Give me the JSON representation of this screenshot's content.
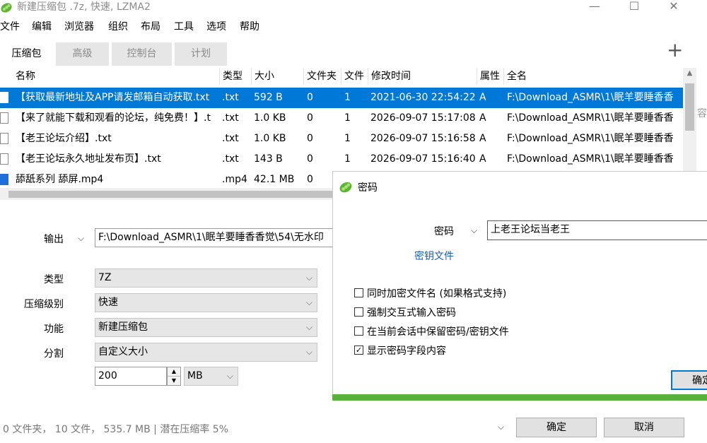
{
  "window": {
    "title": "新建压缩包 .7z, 快速, LZMA2",
    "minimize": "—",
    "maximize": "☐",
    "close": "✕"
  },
  "menu": [
    "文件",
    "编辑",
    "浏览器",
    "组织",
    "布局",
    "工具",
    "选项",
    "帮助"
  ],
  "tabs": [
    "压缩包",
    "高级",
    "控制台",
    "计划"
  ],
  "add_icon": "+",
  "columns": [
    "名称",
    "类型",
    "大小",
    "文件夹",
    "文件",
    "修改时间",
    "属性",
    "全名"
  ],
  "files": [
    {
      "name": "【获取最新地址及APP请发邮箱自动获取.txt",
      "type": ".txt",
      "size": "592 B",
      "folders": "0",
      "files": "1",
      "modified": "2021-06-30 22:54:22",
      "attr": "A",
      "fullname": "F:\\Download_ASMR\\1\\眠羊要睡香香"
    },
    {
      "name": "【来了就能下载和观看的论坛，纯免费！】.t",
      "type": ".txt",
      "size": "1.0 KB",
      "folders": "0",
      "files": "1",
      "modified": "2026-09-07 15:17:08",
      "attr": "A",
      "fullname": "F:\\Download_ASMR\\1\\眠羊要睡香香"
    },
    {
      "name": "【老王论坛介绍】.txt",
      "type": ".txt",
      "size": "1.0 KB",
      "folders": "0",
      "files": "1",
      "modified": "2026-09-07 15:16:58",
      "attr": "A",
      "fullname": "F:\\Download_ASMR\\1\\眠羊要睡香香"
    },
    {
      "name": "【老王论坛永久地址发布页】.txt",
      "type": ".txt",
      "size": "143 B",
      "folders": "0",
      "files": "1",
      "modified": "2026-09-07 15:16:40",
      "attr": "A",
      "fullname": "F:\\Download_ASMR\\1\\眠羊要睡香香"
    },
    {
      "name": "舔舐系列 舔屏.mp4",
      "type": ".mp4",
      "size": "42.1 MB",
      "folders": "0",
      "files": "",
      "modified": "",
      "attr": "",
      "fullname": ""
    }
  ],
  "form": {
    "output_label": "输出",
    "output_value": "F:\\Download_ASMR\\1\\眠羊要睡香香觉\\54\\无水印",
    "type_label": "类型",
    "type_value": "7Z",
    "level_label": "压缩级别",
    "level_value": "快速",
    "function_label": "功能",
    "function_value": "新建压缩包",
    "split_label": "分割",
    "split_value": "自定义大小",
    "split_size": "200",
    "split_unit": "MB"
  },
  "status": "0 文件夹， 10 文件， 535.7 MB | 潜在压缩率 5%",
  "buttons": {
    "ok": "确定",
    "cancel": "取消"
  },
  "side_fragment": "容别",
  "dialog": {
    "title": "密码",
    "password_label": "密码",
    "password_value": "上老王论坛当老王",
    "keyfile_link": "密钥文件",
    "options": [
      {
        "label": "同时加密文件名 (如果格式支持)",
        "checked": false
      },
      {
        "label": "强制交互式输入密码",
        "checked": false
      },
      {
        "label": "在当前会话中保留密码/密钥文件",
        "checked": false
      },
      {
        "label": "显示密码字段内容",
        "checked": true
      }
    ],
    "ok": "确定",
    "accent_color": "#59b33b"
  },
  "colors": {
    "selection": "#0078d7",
    "link": "#1a5fb4"
  }
}
